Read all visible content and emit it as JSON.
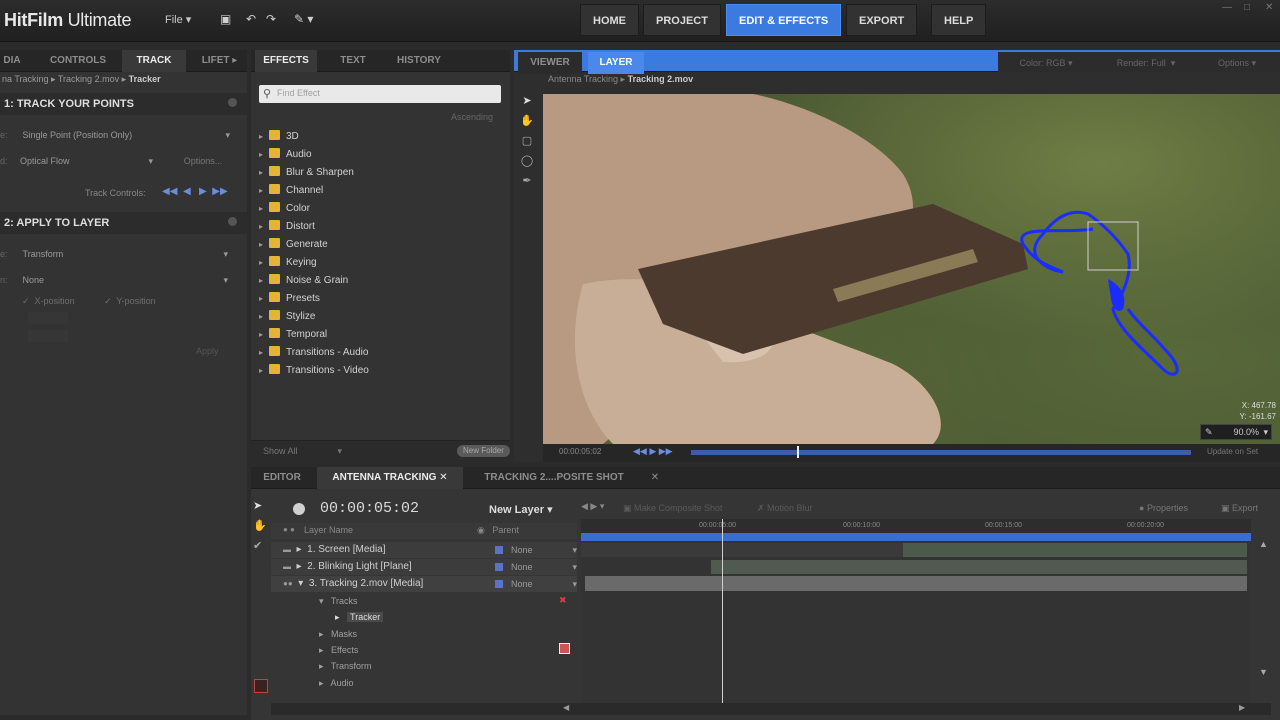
{
  "app": {
    "title_bold": "HitFilm",
    "title_rest": " Ultimate",
    "file_menu": "File"
  },
  "nav": [
    "HOME",
    "PROJECT",
    "EDIT & EFFECTS",
    "EXPORT",
    "HELP"
  ],
  "left_panel": {
    "tabs": [
      "DIA",
      "CONTROLS",
      "TRACK",
      "LIFET"
    ],
    "breadcrumb": [
      "na Tracking",
      "Tracking 2.mov",
      "Tracker"
    ],
    "section1": "1: TRACK YOUR POINTS",
    "track_type": "Single Point (Position Only)",
    "method": "Optical Flow",
    "options_btn": "Options...",
    "track_controls_label": "Track Controls:",
    "section2": "2: APPLY TO LAYER",
    "apply_mode": "Transform",
    "apply_target": "None",
    "x_position": "X-position",
    "y_position": "Y-position",
    "apply_btn": "Apply"
  },
  "effects_panel": {
    "tabs": [
      "EFFECTS",
      "TEXT",
      "HISTORY"
    ],
    "search_placeholder": "Find Effect",
    "sort_label": "Ascending",
    "categories": [
      "3D",
      "Audio",
      "Blur & Sharpen",
      "Channel",
      "Color",
      "Distort",
      "Generate",
      "Keying",
      "Noise & Grain",
      "Presets",
      "Stylize",
      "Temporal",
      "Transitions - Audio",
      "Transitions - Video"
    ],
    "filter": "Show All",
    "new_folder": "New Folder"
  },
  "viewer": {
    "tabs": [
      "VIEWER",
      "LAYER"
    ],
    "color": "Color: RGB",
    "render": "Render: Full",
    "options": "Options",
    "breadcrumb": [
      "Antenna Tracking",
      "Tracking 2.mov"
    ],
    "coord_x": "467.78",
    "coord_y": "-161.67",
    "zoom": "90.0%",
    "timecode": "00:00:05:02",
    "update_btn": "Update on Set"
  },
  "timeline": {
    "tabs": [
      "EDITOR",
      "ANTENNA TRACKING",
      "TRACKING 2....POSITE SHOT"
    ],
    "timecode": "00:00:05:02",
    "new_layer": "New Layer",
    "make_composite": "Make Composite Shot",
    "motion_blur": "Motion Blur",
    "properties": "Properties",
    "export": "Export",
    "col_layer_name": "Layer Name",
    "col_parent": "Parent",
    "layers": [
      {
        "name": "1. Screen [Media]",
        "parent": "None"
      },
      {
        "name": "2. Blinking Light [Plane]",
        "parent": "None"
      },
      {
        "name": "3. Tracking 2.mov [Media]",
        "parent": "None"
      }
    ],
    "sub_tracks": "Tracks",
    "sub_tracker": "Tracker",
    "sub_masks": "Masks",
    "sub_effects": "Effects",
    "sub_transform": "Transform",
    "sub_audio": "Audio",
    "ruler": [
      "00:00:05:00",
      "00:00:10:00",
      "00:00:15:00",
      "00:00:20:00"
    ],
    "playhead_progress": 0.21
  }
}
